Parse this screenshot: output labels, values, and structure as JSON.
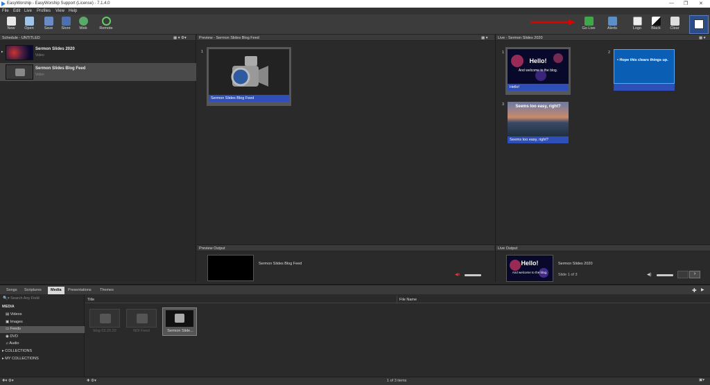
{
  "window": {
    "title": "EasyWorship - EasyWorship Support (License) - 7.1.4.0"
  },
  "menu": [
    "File",
    "Edit",
    "Live",
    "Profiles",
    "View",
    "Help"
  ],
  "toolbar": {
    "new": "New",
    "open": "Open",
    "save": "Save",
    "store": "Store",
    "web": "Web",
    "remote": "Remote",
    "go_live": "Go Live",
    "alerts": "Alerts",
    "logo": "Logo",
    "black": "Black",
    "clear": "Clear"
  },
  "schedule": {
    "header": "Schedule - UNTITLED",
    "items": [
      {
        "title": "Sermon Slides 2020",
        "type": "Video"
      },
      {
        "title": "Sermon Slides Blog Feed",
        "type": "Video"
      }
    ]
  },
  "preview": {
    "header": "Preview - Sermon Slides Blog Feed",
    "slide_num": "1",
    "caption": "Sermon Slides Blog Feed"
  },
  "live": {
    "header": "Live - Sermon Slides 2020",
    "slides": [
      {
        "num": "1",
        "title": "Hello!",
        "body": "And welcome to the blog.",
        "caption": "Hello!"
      },
      {
        "num": "2",
        "text": "• Hope this clears things up.",
        "caption": ""
      },
      {
        "num": "3",
        "title": "Seems too easy, right?",
        "caption": "Seems too easy, right?"
      }
    ]
  },
  "preview_output": {
    "header": "Preview Output",
    "title": "Sermon Slides Blog Feed"
  },
  "live_output": {
    "header": "Live Output",
    "title": "Sermon Slides 2020",
    "slide": "Slide 1 of 3",
    "thumb_title": "Hello!",
    "thumb_body": "And welcome to the blog."
  },
  "tabs": [
    "Songs",
    "Scriptures",
    "Media",
    "Presentations",
    "Themes"
  ],
  "library": {
    "search_placeholder": "Search Any Field",
    "section": "MEDIA",
    "items": [
      "Videos",
      "Images",
      "Feeds",
      "DVD",
      "Audio"
    ],
    "collections": "COLLECTIONS",
    "my_collections": "MY COLLECTIONS"
  },
  "media_list": {
    "col_title": "Title",
    "col_file": "File Name",
    "items": [
      "blog 03.20.20",
      "NDI Feed",
      "Sermon Slide..."
    ]
  },
  "status": {
    "count": "1 of 3 items"
  },
  "colors": {
    "accent": "#2e4fb8",
    "arrow": "#e00000",
    "selected": "#4a4a4a"
  }
}
